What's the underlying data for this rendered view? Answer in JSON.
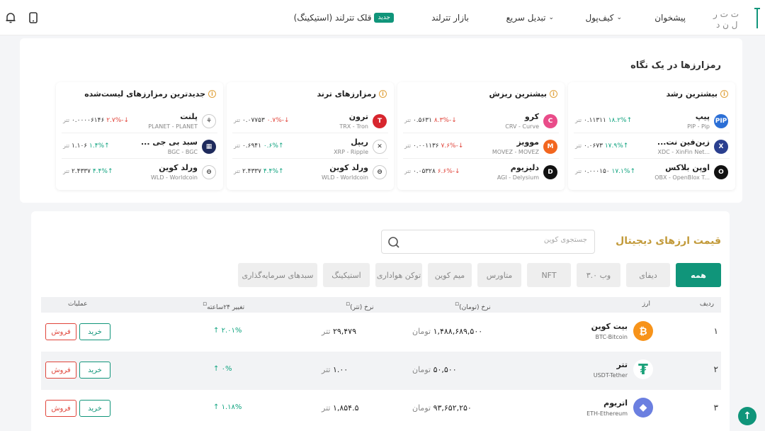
{
  "nav": {
    "offers": "پیشخوان",
    "wallet": "کیف‌پول",
    "quick_swap": "تبدیل سریع",
    "market": "بازار تترلند",
    "staking": "قلک تترلند (استیکینگ)",
    "new_badge": "جدید"
  },
  "overview": {
    "title": "رمزارزها در یک نگاه",
    "unit": "تتر",
    "cards": [
      {
        "title": "بیشترین رشد",
        "rows": [
          {
            "name": "پیپ",
            "symbol": "PIP - Pip",
            "price": "۰.۱۱۳۱۱",
            "change": "۱۸.۲%",
            "dir": "up",
            "color": "#2b6fd6",
            "glyph": "PIP"
          },
          {
            "name": "زین‌فین نت...",
            "symbol": "XDC - XinFin Net...",
            "price": "۰.۰۶۷۳",
            "change": "۱۷.۹%",
            "dir": "up",
            "color": "#2a3f8f",
            "glyph": "X"
          },
          {
            "name": "اوپن بلاکس",
            "symbol": "OBX - OpenBlox T...",
            "price": "۰.۰۰۰۱۵۰",
            "change": "۱۷.۱%",
            "dir": "up",
            "color": "#111111",
            "glyph": "O"
          }
        ]
      },
      {
        "title": "بیشترین ریزش",
        "rows": [
          {
            "name": "کرو",
            "symbol": "CRV - Curve",
            "price": "۰.۵۶۳۱",
            "change": "-۸.۳%",
            "dir": "down",
            "color": "#e94c89",
            "glyph": "C"
          },
          {
            "name": "موویز",
            "symbol": "MOVEZ - MOVEZ",
            "price": "۰.۰۰۱۱۳۶",
            "change": "-۷.۶%",
            "dir": "down",
            "color": "#f2661f",
            "glyph": "M"
          },
          {
            "name": "دلیزیوم",
            "symbol": "AGI - Delysium",
            "price": "۰.۰۵۳۲۸",
            "change": "-۶.۶%",
            "dir": "down",
            "color": "#111111",
            "glyph": "D"
          }
        ]
      },
      {
        "title": "رمزارزهای ترند",
        "rows": [
          {
            "name": "ترون",
            "symbol": "TRX - Tron",
            "price": "۰.۰۷۷۵۳",
            "change": "-۰.۷%",
            "dir": "down",
            "color": "#d7262e",
            "glyph": "T"
          },
          {
            "name": "ریپل",
            "symbol": "XRP - Ripple",
            "price": "۰.۶۹۴۱",
            "change": "۰.۶%",
            "dir": "up",
            "color": "#ffffff",
            "glyph": "✕"
          },
          {
            "name": "ورلد کوین",
            "symbol": "WLD - Worldcoin",
            "price": "۲.۴۳۳۷",
            "change": "۴.۴%",
            "dir": "up",
            "color": "#ffffff",
            "glyph": "⊖"
          }
        ]
      },
      {
        "title": "جدیدترین رمزارزهای لیست‌شده",
        "rows": [
          {
            "name": "پلنت",
            "symbol": "PLANET - PLANET",
            "price": "۰.۰۰۰۰۶۱۴۶",
            "change": "-۲.۷%",
            "dir": "down",
            "color": "#ffffff",
            "glyph": "⚘"
          },
          {
            "name": "سبد بی جی ...",
            "symbol": "BGC - BGC",
            "price": "۱.۱۰۶",
            "change": "۱.۴%",
            "dir": "up",
            "color": "#1e2a5c",
            "glyph": "▦"
          },
          {
            "name": "ورلد کوین",
            "symbol": "WLD - Worldcoin",
            "price": "۲.۴۳۳۷",
            "change": "۴.۴%",
            "dir": "up",
            "color": "#ffffff",
            "glyph": "⊖"
          }
        ]
      }
    ]
  },
  "prices": {
    "title": "قیمت ارزهای دیجیتال",
    "search_placeholder": "جستجوی کوین",
    "filters": [
      "همه",
      "دیفای",
      "وب ۳.۰",
      "NFT",
      "متاورس",
      "میم کوین",
      "توکن هواداری",
      "استیکینگ",
      "سبدهای سرمایه‌گذاری"
    ],
    "headers": {
      "rank": "ردیف",
      "asset": "ارز",
      "toman": "نرخ (تومان)",
      "tether": "نرخ (تتر)",
      "change": "تغییر ۲۴ساعته",
      "actions": "عملیات"
    },
    "unit_toman": "تومان",
    "unit_tether": "تتر",
    "buy_label": "خرید",
    "sell_label": "فروش",
    "rows": [
      {
        "rank": "۱",
        "name": "بیت کوین",
        "symbol": "BTC-Bitcoin",
        "toman": "۱,۴۸۸,۶۸۹,۵۰۰",
        "tether": "۲۹,۴۷۹",
        "change": "۲.۰۱%",
        "color": "#f7931a",
        "glyph": "₿"
      },
      {
        "rank": "۲",
        "name": "تتر",
        "symbol": "USDT-Tether",
        "toman": "۵۰,۵۰۰",
        "tether": "۱.۰۰",
        "change": "۰%",
        "color": "#ffffff",
        "glyph": "₮"
      },
      {
        "rank": "۳",
        "name": "اتریوم",
        "symbol": "ETH-Ethereum",
        "toman": "۹۳,۶۵۲,۲۵۰",
        "tether": "۱,۸۵۴.۵",
        "change": "۱.۱۸%",
        "color": "#6b7fe0",
        "glyph": "◆"
      }
    ]
  },
  "colors": {
    "brand_green": "#10957a",
    "gold": "#c29a3a",
    "up": "#0fa37f",
    "down": "#e0443a"
  }
}
